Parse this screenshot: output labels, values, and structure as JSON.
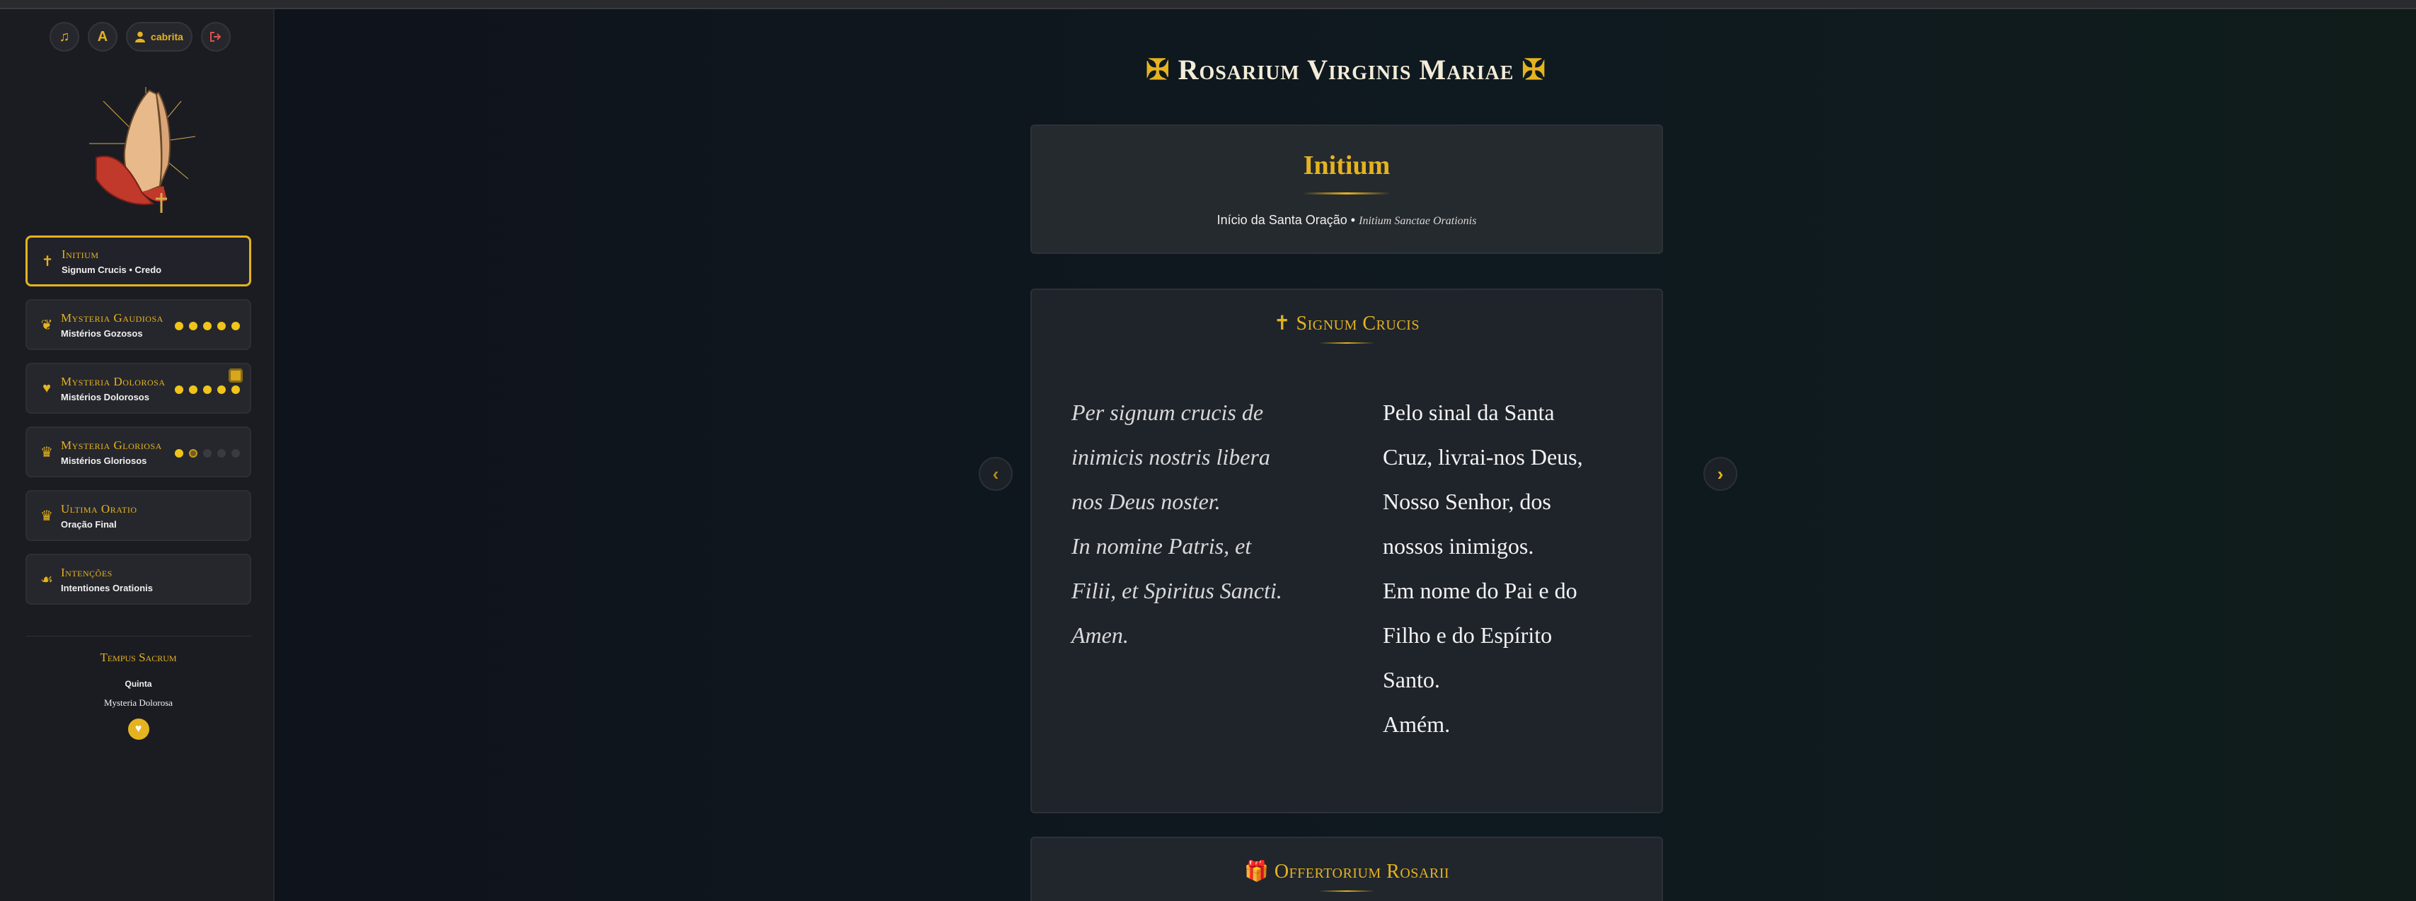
{
  "controls": {
    "music_icon": "music-note-icon",
    "font_label": "A",
    "user_name": "cabrita",
    "logout_icon": "logout-icon"
  },
  "sidebar": {
    "items": [
      {
        "title": "Initium",
        "subtitle": "Signum Crucis • Credo",
        "icon": "cross-icon",
        "active": true
      },
      {
        "title": "Mysteria Gaudiosa",
        "subtitle": "Mistérios Gozosos",
        "icon": "dove-icon",
        "progress": [
          1,
          1,
          1,
          1,
          1
        ]
      },
      {
        "title": "Mysteria Dolorosa",
        "subtitle": "Mistérios Dolorosos",
        "icon": "heart-icon",
        "progress": [
          1,
          1,
          1,
          1,
          1
        ]
      },
      {
        "title": "Mysteria Gloriosa",
        "subtitle": "Mistérios Gloriosos",
        "icon": "crown-icon",
        "progress": [
          1,
          0.5,
          0,
          0,
          0
        ]
      },
      {
        "title": "Ultima Oratio",
        "subtitle": "Oração Final",
        "icon": "crown-icon"
      },
      {
        "title": "Intenções",
        "subtitle": "Intentiones Orationis",
        "icon": "praying-hands-icon"
      }
    ],
    "tempus": {
      "title": "Tempus Sacrum",
      "day": "Quinta",
      "mystery": "Mysteria Dolorosa"
    }
  },
  "main": {
    "page_title": "Rosarium Virginis Mariae",
    "title_cross": "✠",
    "initium": {
      "title": "Initium",
      "subtitle_pt": "Início da Santa Oração •",
      "subtitle_lat": "Initium Sanctae Orationis"
    },
    "signum": {
      "title": "Signum Crucis",
      "latin": [
        "Per signum crucis de",
        "inimicis nostris libera",
        "nos Deus noster.",
        "In nomine Patris, et",
        "Filii, et Spiritus Sancti.",
        "Amen."
      ],
      "portuguese": [
        "Pelo sinal da Santa",
        "Cruz, livrai-nos Deus,",
        "Nosso Senhor, dos",
        "nossos inimigos.",
        "Em nome do Pai e do",
        "Filho e do Espírito",
        "Santo.",
        "Amém."
      ]
    },
    "next_section": {
      "title": "Offertorium Rosarii"
    }
  },
  "colors": {
    "accent": "#e5b320",
    "sidebar_bg": "#1b1c22",
    "card_bg": "#21262c"
  }
}
